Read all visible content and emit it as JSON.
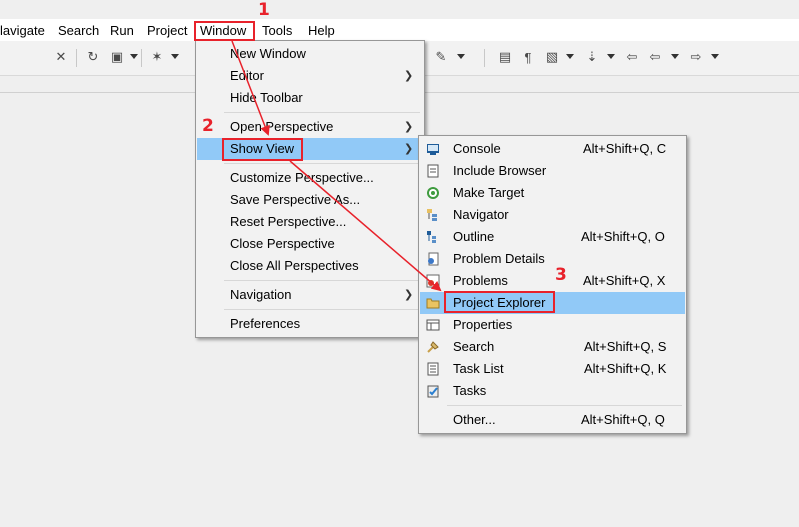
{
  "menubar": {
    "items": [
      "lavigate",
      "Search",
      "Run",
      "Project",
      "Window",
      "Tools",
      "Help"
    ]
  },
  "window_menu": {
    "items": [
      "New Window",
      "Editor",
      "Hide Toolbar",
      "Open Perspective",
      "Show View",
      "Customize Perspective...",
      "Save Perspective As...",
      "Reset Perspective...",
      "Close Perspective",
      "Close All Perspectives",
      "Navigation",
      "Preferences"
    ]
  },
  "show_view_menu": {
    "items": [
      {
        "label": "Console",
        "shortcut": "Alt+Shift+Q, C",
        "icon": "console-icon"
      },
      {
        "label": "Include Browser",
        "shortcut": "",
        "icon": "include-browser-icon"
      },
      {
        "label": "Make Target",
        "shortcut": "",
        "icon": "make-target-icon"
      },
      {
        "label": "Navigator",
        "shortcut": "",
        "icon": "navigator-icon"
      },
      {
        "label": "Outline",
        "shortcut": "Alt+Shift+Q, O",
        "icon": "outline-icon"
      },
      {
        "label": "Problem Details",
        "shortcut": "",
        "icon": "problem-details-icon"
      },
      {
        "label": "Problems",
        "shortcut": "Alt+Shift+Q, X",
        "icon": "problems-icon"
      },
      {
        "label": "Project Explorer",
        "shortcut": "",
        "icon": "project-explorer-icon"
      },
      {
        "label": "Properties",
        "shortcut": "",
        "icon": "properties-icon"
      },
      {
        "label": "Search",
        "shortcut": "Alt+Shift+Q, S",
        "icon": "search-icon"
      },
      {
        "label": "Task List",
        "shortcut": "Alt+Shift+Q, K",
        "icon": "task-list-icon"
      },
      {
        "label": "Tasks",
        "shortcut": "",
        "icon": "tasks-icon"
      },
      {
        "label": "Other...",
        "shortcut": "Alt+Shift+Q, Q",
        "icon": ""
      }
    ]
  },
  "annotations": {
    "step1": "1",
    "step2": "2",
    "step3": "3"
  },
  "colors": {
    "highlight": "#91c9f7",
    "annotation": "#e8222b",
    "menu_bg": "#f2f2f2"
  }
}
